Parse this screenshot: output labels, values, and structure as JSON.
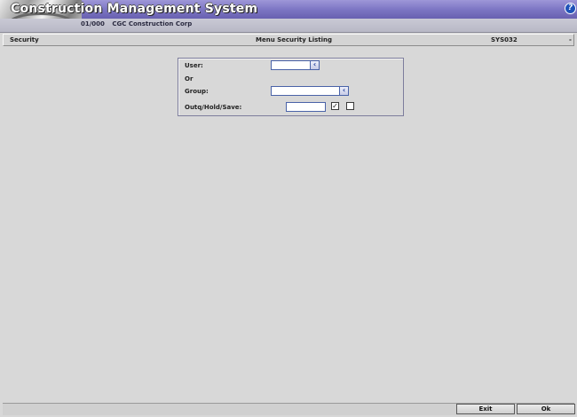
{
  "app": {
    "title": "Construction Management System",
    "company_code": "01/000",
    "company_name": "CGC Construction Corp",
    "help_icon": "?"
  },
  "titlebar": {
    "module": "Security",
    "screen_title": "Menu Security Listing",
    "program": "SYS032",
    "dash": "-"
  },
  "form": {
    "user_label": "User:",
    "user_value": "",
    "or_label": "Or",
    "group_label": "Group:",
    "group_value": "",
    "outq_label": "Outq/Hold/Save:",
    "outq_value": "",
    "hold_checked": true,
    "save_checked": false,
    "hold_mark": "✓",
    "lookup_glyph": "‹"
  },
  "buttons": {
    "exit_label": "Exit",
    "ok_label": "Ok"
  },
  "colors": {
    "banner": "#7d76c4",
    "background": "#d8d8d8",
    "field_border": "#4a63a8"
  }
}
